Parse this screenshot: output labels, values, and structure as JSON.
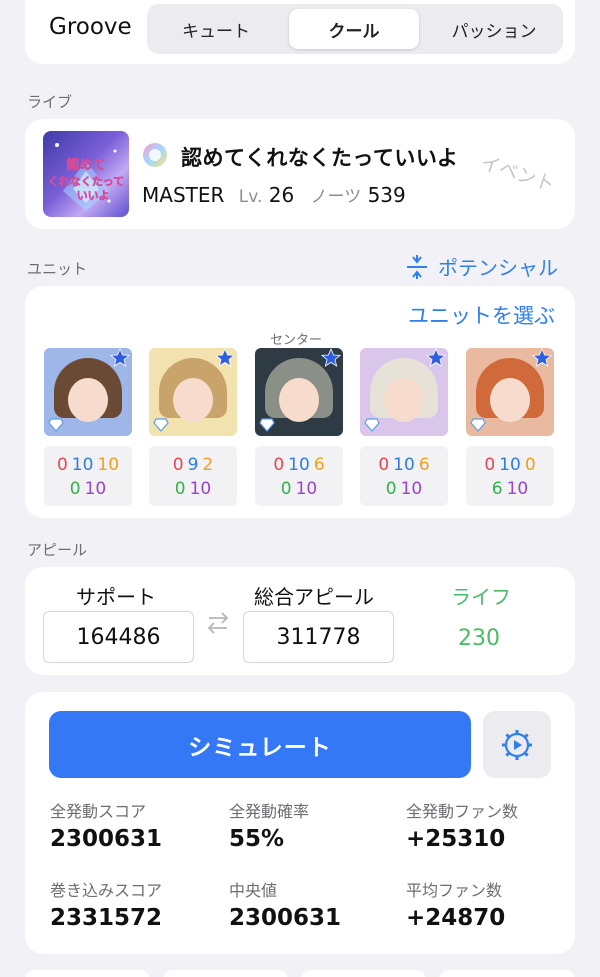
{
  "header": {
    "groove_label": "Groove",
    "tabs": [
      {
        "label": "キュート",
        "active": false
      },
      {
        "label": "クール",
        "active": true
      },
      {
        "label": "パッション",
        "active": false
      }
    ]
  },
  "live": {
    "section_label": "ライブ",
    "song_title": "認めてくれなくたっていいよ",
    "event_tag": "イベント",
    "difficulty": "MASTER",
    "level_label": "Lv.",
    "level": "26",
    "notes_label": "ノーツ",
    "notes": "539",
    "jacket_text": "認めてくれなくたっていいよ"
  },
  "unit": {
    "section_label": "ユニット",
    "potential_label": "ポテンシャル",
    "choose_label": "ユニットを選ぶ",
    "center_label": "センター",
    "members": [
      {
        "hair": "#6b4a35",
        "bg": "#9fb6e8",
        "stats": [
          "0",
          "10",
          "10",
          "0",
          "10"
        ]
      },
      {
        "hair": "#c9a46a",
        "bg": "#f1e2b0",
        "stats": [
          "0",
          "9",
          "2",
          "0",
          "10"
        ]
      },
      {
        "hair": "#8a9088",
        "bg": "#2e3a44",
        "stats": [
          "0",
          "10",
          "6",
          "0",
          "10"
        ]
      },
      {
        "hair": "#e6e2d8",
        "bg": "#d9c6ea",
        "stats": [
          "0",
          "10",
          "6",
          "0",
          "10"
        ]
      },
      {
        "hair": "#d06a3a",
        "bg": "#e9b9a0",
        "stats": [
          "0",
          "10",
          "0",
          "6",
          "10"
        ]
      }
    ]
  },
  "appeal": {
    "section_label": "アピール",
    "support_label": "サポート",
    "support_value": "164486",
    "total_label": "総合アピール",
    "total_value": "311778",
    "life_label": "ライフ",
    "life_value": "230"
  },
  "simulation": {
    "button_label": "シミュレート",
    "results": [
      {
        "label": "全発動スコア",
        "value": "2300631"
      },
      {
        "label": "全発動確率",
        "value": "55%"
      },
      {
        "label": "全発動ファン数",
        "value": "+25310"
      },
      {
        "label": "巻き込みスコア",
        "value": "2331572"
      },
      {
        "label": "中央値",
        "value": "2300631"
      },
      {
        "label": "平均ファン数",
        "value": "+24870"
      }
    ]
  },
  "colors": {
    "accent": "#2f80ed",
    "button": "#3478f6",
    "life": "#4cbb6a",
    "background": "#f2f2f6"
  }
}
